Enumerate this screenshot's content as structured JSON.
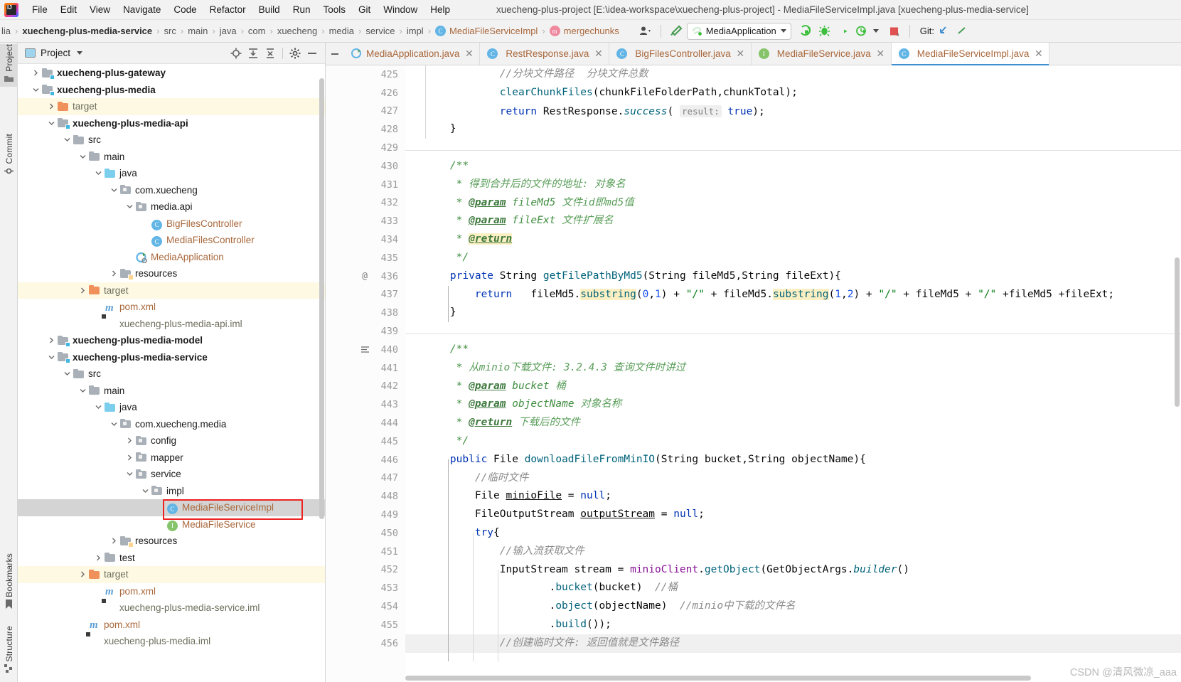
{
  "window": {
    "title": "xuecheng-plus-project [E:\\idea-workspace\\xuecheng-plus-project] - MediaFileServiceImpl.java [xuecheng-plus-media-service]",
    "logo_icon": "intellij-idea-logo"
  },
  "menubar": {
    "items": [
      {
        "label": "File",
        "mnemonic": "F"
      },
      {
        "label": "Edit",
        "mnemonic": "E"
      },
      {
        "label": "View",
        "mnemonic": "V"
      },
      {
        "label": "Navigate",
        "mnemonic": "N"
      },
      {
        "label": "Code",
        "mnemonic": "C"
      },
      {
        "label": "Refactor",
        "mnemonic": "R"
      },
      {
        "label": "Build",
        "mnemonic": "B"
      },
      {
        "label": "Run",
        "mnemonic": "R"
      },
      {
        "label": "Tools",
        "mnemonic": "T"
      },
      {
        "label": "Git",
        "mnemonic": "G"
      },
      {
        "label": "Window",
        "mnemonic": "W"
      },
      {
        "label": "Help",
        "mnemonic": "H"
      }
    ]
  },
  "navbar": {
    "breadcrumbs": [
      {
        "label": "lia",
        "style": "dim",
        "icon": ""
      },
      {
        "label": "xuecheng-plus-media-service",
        "style": "bold",
        "icon": ""
      },
      {
        "label": "src",
        "style": "dim",
        "icon": ""
      },
      {
        "label": "main",
        "style": "dim",
        "icon": ""
      },
      {
        "label": "java",
        "style": "dim",
        "icon": ""
      },
      {
        "label": "com",
        "style": "dim",
        "icon": ""
      },
      {
        "label": "xuecheng",
        "style": "dim",
        "icon": ""
      },
      {
        "label": "media",
        "style": "dim",
        "icon": ""
      },
      {
        "label": "service",
        "style": "dim",
        "icon": ""
      },
      {
        "label": "impl",
        "style": "dim",
        "icon": ""
      },
      {
        "label": "MediaFileServiceImpl",
        "style": "orange",
        "icon": "class-icon"
      },
      {
        "label": "mergechunks",
        "style": "orange",
        "icon": "method-icon"
      }
    ],
    "run_config": "MediaApplication",
    "git_label": "Git:",
    "icons": [
      "user-avatar-icon",
      "hammer-build-icon",
      "spring-run-config-icon",
      "run-icon",
      "debug-icon",
      "run-with-coverage-icon",
      "profiler-icon",
      "stop-icon",
      "git-update-icon"
    ]
  },
  "rail": {
    "left_items": [
      {
        "label": "Project",
        "icon": "project-icon",
        "selected": true
      },
      {
        "label": "Commit",
        "icon": "commit-icon",
        "selected": false
      },
      {
        "label": "Bookmarks",
        "icon": "bookmark-icon",
        "selected": false
      },
      {
        "label": "Structure",
        "icon": "structure-icon",
        "selected": false
      }
    ]
  },
  "project_panel": {
    "title": "Project",
    "actions": [
      "locate-icon",
      "expand-all-icon",
      "collapse-all-icon",
      "settings-gear-icon",
      "hide-icon"
    ],
    "tree": [
      {
        "label": "xuecheng-plus-gateway",
        "indent": 1,
        "arrow": "collapsed",
        "icon": "module-folder-icon",
        "style": "bold"
      },
      {
        "label": "xuecheng-plus-media",
        "indent": 1,
        "arrow": "expanded",
        "icon": "module-folder-icon",
        "style": "bold"
      },
      {
        "label": "target",
        "indent": 2,
        "arrow": "collapsed",
        "icon": "excluded-folder-icon",
        "style": "gray",
        "row": "yellow"
      },
      {
        "label": "xuecheng-plus-media-api",
        "indent": 2,
        "arrow": "expanded",
        "icon": "module-folder-icon",
        "style": "bold"
      },
      {
        "label": "src",
        "indent": 3,
        "arrow": "expanded",
        "icon": "folder-icon",
        "style": "plain"
      },
      {
        "label": "main",
        "indent": 4,
        "arrow": "expanded",
        "icon": "folder-icon",
        "style": "plain"
      },
      {
        "label": "java",
        "indent": 5,
        "arrow": "expanded",
        "icon": "source-folder-icon",
        "style": "plain"
      },
      {
        "label": "com.xuecheng",
        "indent": 6,
        "arrow": "expanded",
        "icon": "package-icon",
        "style": "plain"
      },
      {
        "label": "media.api",
        "indent": 7,
        "arrow": "expanded",
        "icon": "package-icon",
        "style": "plain"
      },
      {
        "label": "BigFilesController",
        "indent": 8,
        "arrow": "none",
        "icon": "class-icon",
        "style": "orange"
      },
      {
        "label": "MediaFilesController",
        "indent": 8,
        "arrow": "none",
        "icon": "class-icon",
        "style": "orange"
      },
      {
        "label": "MediaApplication",
        "indent": 7,
        "arrow": "none",
        "icon": "spring-boot-class-icon",
        "style": "orange"
      },
      {
        "label": "resources",
        "indent": 6,
        "arrow": "collapsed",
        "icon": "resources-folder-icon",
        "style": "plain"
      },
      {
        "label": "target",
        "indent": 4,
        "arrow": "collapsed",
        "icon": "excluded-folder-icon",
        "style": "gray",
        "row": "yellow"
      },
      {
        "label": "pom.xml",
        "indent": 5,
        "arrow": "none",
        "icon": "maven-icon",
        "style": "orange"
      },
      {
        "label": "xuecheng-plus-media-api.iml",
        "indent": 5,
        "arrow": "none",
        "icon": "iml-icon",
        "style": "gray"
      },
      {
        "label": "xuecheng-plus-media-model",
        "indent": 2,
        "arrow": "collapsed",
        "icon": "module-folder-icon",
        "style": "bold"
      },
      {
        "label": "xuecheng-plus-media-service",
        "indent": 2,
        "arrow": "expanded",
        "icon": "module-folder-icon",
        "style": "bold"
      },
      {
        "label": "src",
        "indent": 3,
        "arrow": "expanded",
        "icon": "folder-icon",
        "style": "plain"
      },
      {
        "label": "main",
        "indent": 4,
        "arrow": "expanded",
        "icon": "folder-icon",
        "style": "plain"
      },
      {
        "label": "java",
        "indent": 5,
        "arrow": "expanded",
        "icon": "source-folder-icon",
        "style": "plain"
      },
      {
        "label": "com.xuecheng.media",
        "indent": 6,
        "arrow": "expanded",
        "icon": "package-icon",
        "style": "plain"
      },
      {
        "label": "config",
        "indent": 7,
        "arrow": "collapsed",
        "icon": "package-icon",
        "style": "plain"
      },
      {
        "label": "mapper",
        "indent": 7,
        "arrow": "collapsed",
        "icon": "package-icon",
        "style": "plain"
      },
      {
        "label": "service",
        "indent": 7,
        "arrow": "expanded",
        "icon": "package-icon",
        "style": "plain"
      },
      {
        "label": "impl",
        "indent": 8,
        "arrow": "expanded",
        "icon": "package-icon",
        "style": "plain"
      },
      {
        "label": "MediaFileServiceImpl",
        "indent": 9,
        "arrow": "none",
        "icon": "class-icon",
        "style": "orange",
        "row": "selected",
        "highlight_box": true
      },
      {
        "label": "MediaFileService",
        "indent": 9,
        "arrow": "none",
        "icon": "interface-icon",
        "style": "orange"
      },
      {
        "label": "resources",
        "indent": 6,
        "arrow": "collapsed",
        "icon": "resources-folder-icon",
        "style": "plain"
      },
      {
        "label": "test",
        "indent": 5,
        "arrow": "collapsed",
        "icon": "folder-icon",
        "style": "plain"
      },
      {
        "label": "target",
        "indent": 4,
        "arrow": "collapsed",
        "icon": "excluded-folder-icon",
        "style": "gray",
        "row": "yellow"
      },
      {
        "label": "pom.xml",
        "indent": 5,
        "arrow": "none",
        "icon": "maven-icon",
        "style": "orange"
      },
      {
        "label": "xuecheng-plus-media-service.iml",
        "indent": 5,
        "arrow": "none",
        "icon": "iml-icon",
        "style": "gray"
      },
      {
        "label": "pom.xml",
        "indent": 4,
        "arrow": "none",
        "icon": "maven-icon",
        "style": "orange"
      },
      {
        "label": "xuecheng-plus-media.iml",
        "indent": 4,
        "arrow": "none",
        "icon": "iml-icon",
        "style": "gray"
      }
    ]
  },
  "editor": {
    "tabs": [
      {
        "label": "MediaApplication.java",
        "icon": "spring-boot-class-icon",
        "active": false
      },
      {
        "label": "RestResponse.java",
        "icon": "class-icon",
        "active": false
      },
      {
        "label": "BigFilesController.java",
        "icon": "class-icon",
        "active": false
      },
      {
        "label": "MediaFileService.java",
        "icon": "interface-icon",
        "active": false
      },
      {
        "label": "MediaFileServiceImpl.java",
        "icon": "class-icon",
        "active": true
      }
    ],
    "first_line_number": 425,
    "line_numbers": [
      425,
      426,
      427,
      428,
      429,
      430,
      431,
      432,
      433,
      434,
      435,
      436,
      437,
      438,
      439,
      440,
      441,
      442,
      443,
      444,
      445,
      446,
      447,
      448,
      449,
      450,
      451,
      452,
      453,
      454,
      455,
      456
    ],
    "lines": [
      "            //分块文件路径  分块文件总数",
      "            clearChunkFiles(chunkFileFolderPath,chunkTotal);",
      "            return RestResponse.success( result: true);",
      "    }",
      "",
      "    /**",
      "     * 得到合并后的文件的地址: 对象名",
      "     * @param fileMd5 文件id即md5值",
      "     * @param fileExt 文件扩展名",
      "     * @return",
      "     */",
      "    private String getFilePathByMd5(String fileMd5,String fileExt){",
      "        return   fileMd5.substring(0,1) + \"/\" + fileMd5.substring(1,2) + \"/\" + fileMd5 + \"/\" +fileMd5 +fileExt;",
      "    }",
      "",
      "    /**",
      "     * 从minio下载文件: 3.2.4.3 查询文件时讲过",
      "     * @param bucket 桶",
      "     * @param objectName 对象名称",
      "     * @return 下载后的文件",
      "     */",
      "    public File downloadFileFromMinIO(String bucket,String objectName){",
      "        //临时文件",
      "        File minioFile = null;",
      "        FileOutputStream outputStream = null;",
      "        try{",
      "            //输入流获取文件",
      "            InputStream stream = minioClient.getObject(GetObjectArgs.builder()",
      "                    .bucket(bucket)  //桶",
      "                    .object(objectName)  //minio中下载的文件名",
      "                    .build());",
      "            //创建临时文件: 返回值就是文件路径"
    ],
    "gutter_annotation": "@"
  },
  "watermark": "CSDN @清风微凉_aaa",
  "colors": {
    "accent_blue": "#3f8fd0",
    "keyword": "#0033b3",
    "string": "#067d17",
    "comment": "#8c8c8c",
    "javadoc": "#418e41",
    "class_orange": "#a9683c",
    "selection": "#d4d4d4",
    "highlight_yellow": "#fdf9e3",
    "red_box": "#ee2222"
  }
}
